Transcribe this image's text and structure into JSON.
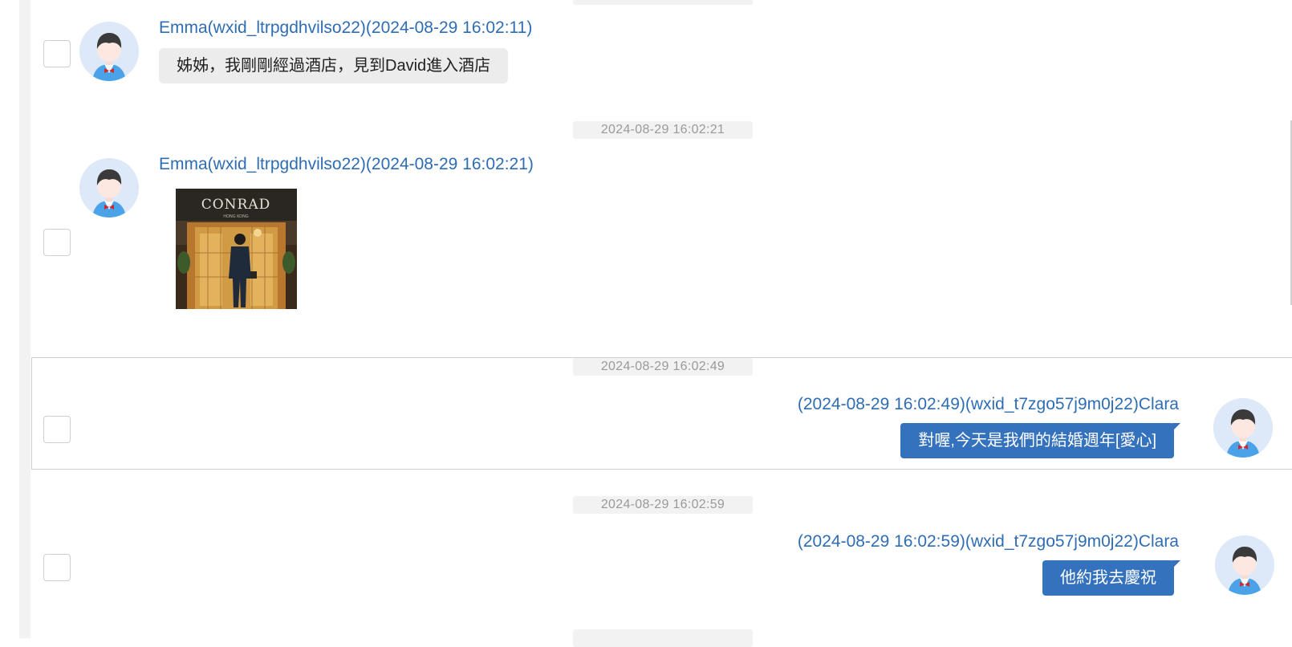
{
  "messages": [
    {
      "sender_label": "Emma(wxid_ltrpgdhvilso22)(2024-08-29 16:02:11)",
      "text": "姊姊，我剛剛經過酒店，見到David進入酒店",
      "direction": "incoming"
    },
    {
      "timestamp": "2024-08-29 16:02:21",
      "sender_label": "Emma(wxid_ltrpgdhvilso22)(2024-08-29 16:02:21)",
      "image": {
        "sign_text": "CONRAD",
        "sign_subtext": "HONG KONG"
      },
      "direction": "incoming"
    },
    {
      "timestamp": "2024-08-29 16:02:49",
      "sender_label": "(2024-08-29 16:02:49)(wxid_t7zgo57j9m0j22)Clara",
      "text": "對喔,今天是我們的結婚週年[愛心]",
      "direction": "outgoing",
      "selected": true
    },
    {
      "timestamp": "2024-08-29 16:02:59",
      "sender_label": "(2024-08-29 16:02:59)(wxid_t7zgo57j9m0j22)Clara",
      "text": "他約我去慶祝",
      "direction": "outgoing"
    }
  ],
  "colors": {
    "accent": "#2e6db4",
    "outgoing_bubble": "#3572be",
    "incoming_bubble": "#ececec",
    "timestamp_pill": "#f2f2f2"
  }
}
